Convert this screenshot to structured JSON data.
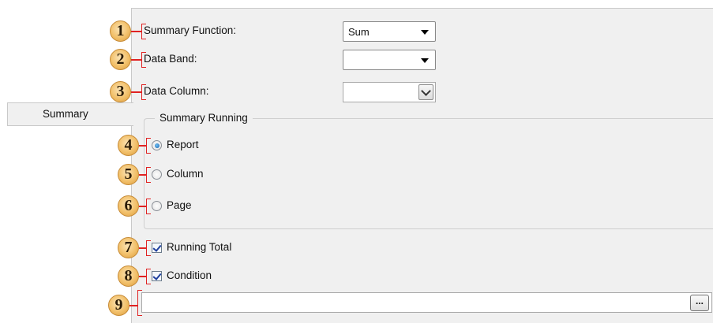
{
  "tab": {
    "label": "Summary"
  },
  "callouts": [
    "1",
    "2",
    "3",
    "4",
    "5",
    "6",
    "7",
    "8",
    "9"
  ],
  "fields": {
    "summary_function": {
      "label": "Summary Function:",
      "value": "Sum"
    },
    "data_band": {
      "label": "Data Band:",
      "value": ""
    },
    "data_column": {
      "label": "Data Column:",
      "value": ""
    }
  },
  "summary_running": {
    "legend": "Summary Running",
    "options": [
      {
        "label": "Report",
        "checked": true
      },
      {
        "label": "Column",
        "checked": false
      },
      {
        "label": "Page",
        "checked": false
      }
    ]
  },
  "checkboxes": {
    "running_total": {
      "label": "Running Total",
      "checked": true
    },
    "condition": {
      "label": "Condition",
      "checked": true
    }
  },
  "condition_expression": {
    "value": "",
    "browse_label": "..."
  },
  "icons": [
    "chevron-down-icon",
    "ellipsis-icon"
  ],
  "colors": {
    "panel_bg": "#f0f0f0",
    "callout": "#f2c06a",
    "marker_red": "#e02222",
    "check_blue": "#1f3f9e"
  }
}
